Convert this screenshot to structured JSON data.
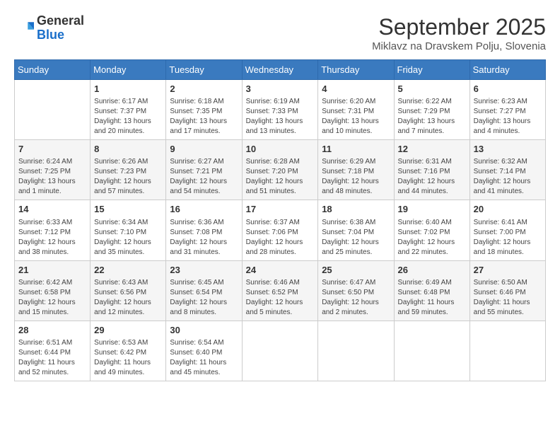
{
  "header": {
    "logo": {
      "general": "General",
      "blue": "Blue"
    },
    "title": "September 2025",
    "subtitle": "Miklavz na Dravskem Polju, Slovenia"
  },
  "days_of_week": [
    "Sunday",
    "Monday",
    "Tuesday",
    "Wednesday",
    "Thursday",
    "Friday",
    "Saturday"
  ],
  "weeks": [
    [
      {
        "day": "",
        "info": ""
      },
      {
        "day": "1",
        "info": "Sunrise: 6:17 AM\nSunset: 7:37 PM\nDaylight: 13 hours\nand 20 minutes."
      },
      {
        "day": "2",
        "info": "Sunrise: 6:18 AM\nSunset: 7:35 PM\nDaylight: 13 hours\nand 17 minutes."
      },
      {
        "day": "3",
        "info": "Sunrise: 6:19 AM\nSunset: 7:33 PM\nDaylight: 13 hours\nand 13 minutes."
      },
      {
        "day": "4",
        "info": "Sunrise: 6:20 AM\nSunset: 7:31 PM\nDaylight: 13 hours\nand 10 minutes."
      },
      {
        "day": "5",
        "info": "Sunrise: 6:22 AM\nSunset: 7:29 PM\nDaylight: 13 hours\nand 7 minutes."
      },
      {
        "day": "6",
        "info": "Sunrise: 6:23 AM\nSunset: 7:27 PM\nDaylight: 13 hours\nand 4 minutes."
      }
    ],
    [
      {
        "day": "7",
        "info": "Sunrise: 6:24 AM\nSunset: 7:25 PM\nDaylight: 13 hours\nand 1 minute."
      },
      {
        "day": "8",
        "info": "Sunrise: 6:26 AM\nSunset: 7:23 PM\nDaylight: 12 hours\nand 57 minutes."
      },
      {
        "day": "9",
        "info": "Sunrise: 6:27 AM\nSunset: 7:21 PM\nDaylight: 12 hours\nand 54 minutes."
      },
      {
        "day": "10",
        "info": "Sunrise: 6:28 AM\nSunset: 7:20 PM\nDaylight: 12 hours\nand 51 minutes."
      },
      {
        "day": "11",
        "info": "Sunrise: 6:29 AM\nSunset: 7:18 PM\nDaylight: 12 hours\nand 48 minutes."
      },
      {
        "day": "12",
        "info": "Sunrise: 6:31 AM\nSunset: 7:16 PM\nDaylight: 12 hours\nand 44 minutes."
      },
      {
        "day": "13",
        "info": "Sunrise: 6:32 AM\nSunset: 7:14 PM\nDaylight: 12 hours\nand 41 minutes."
      }
    ],
    [
      {
        "day": "14",
        "info": "Sunrise: 6:33 AM\nSunset: 7:12 PM\nDaylight: 12 hours\nand 38 minutes."
      },
      {
        "day": "15",
        "info": "Sunrise: 6:34 AM\nSunset: 7:10 PM\nDaylight: 12 hours\nand 35 minutes."
      },
      {
        "day": "16",
        "info": "Sunrise: 6:36 AM\nSunset: 7:08 PM\nDaylight: 12 hours\nand 31 minutes."
      },
      {
        "day": "17",
        "info": "Sunrise: 6:37 AM\nSunset: 7:06 PM\nDaylight: 12 hours\nand 28 minutes."
      },
      {
        "day": "18",
        "info": "Sunrise: 6:38 AM\nSunset: 7:04 PM\nDaylight: 12 hours\nand 25 minutes."
      },
      {
        "day": "19",
        "info": "Sunrise: 6:40 AM\nSunset: 7:02 PM\nDaylight: 12 hours\nand 22 minutes."
      },
      {
        "day": "20",
        "info": "Sunrise: 6:41 AM\nSunset: 7:00 PM\nDaylight: 12 hours\nand 18 minutes."
      }
    ],
    [
      {
        "day": "21",
        "info": "Sunrise: 6:42 AM\nSunset: 6:58 PM\nDaylight: 12 hours\nand 15 minutes."
      },
      {
        "day": "22",
        "info": "Sunrise: 6:43 AM\nSunset: 6:56 PM\nDaylight: 12 hours\nand 12 minutes."
      },
      {
        "day": "23",
        "info": "Sunrise: 6:45 AM\nSunset: 6:54 PM\nDaylight: 12 hours\nand 8 minutes."
      },
      {
        "day": "24",
        "info": "Sunrise: 6:46 AM\nSunset: 6:52 PM\nDaylight: 12 hours\nand 5 minutes."
      },
      {
        "day": "25",
        "info": "Sunrise: 6:47 AM\nSunset: 6:50 PM\nDaylight: 12 hours\nand 2 minutes."
      },
      {
        "day": "26",
        "info": "Sunrise: 6:49 AM\nSunset: 6:48 PM\nDaylight: 11 hours\nand 59 minutes."
      },
      {
        "day": "27",
        "info": "Sunrise: 6:50 AM\nSunset: 6:46 PM\nDaylight: 11 hours\nand 55 minutes."
      }
    ],
    [
      {
        "day": "28",
        "info": "Sunrise: 6:51 AM\nSunset: 6:44 PM\nDaylight: 11 hours\nand 52 minutes."
      },
      {
        "day": "29",
        "info": "Sunrise: 6:53 AM\nSunset: 6:42 PM\nDaylight: 11 hours\nand 49 minutes."
      },
      {
        "day": "30",
        "info": "Sunrise: 6:54 AM\nSunset: 6:40 PM\nDaylight: 11 hours\nand 45 minutes."
      },
      {
        "day": "",
        "info": ""
      },
      {
        "day": "",
        "info": ""
      },
      {
        "day": "",
        "info": ""
      },
      {
        "day": "",
        "info": ""
      }
    ]
  ]
}
